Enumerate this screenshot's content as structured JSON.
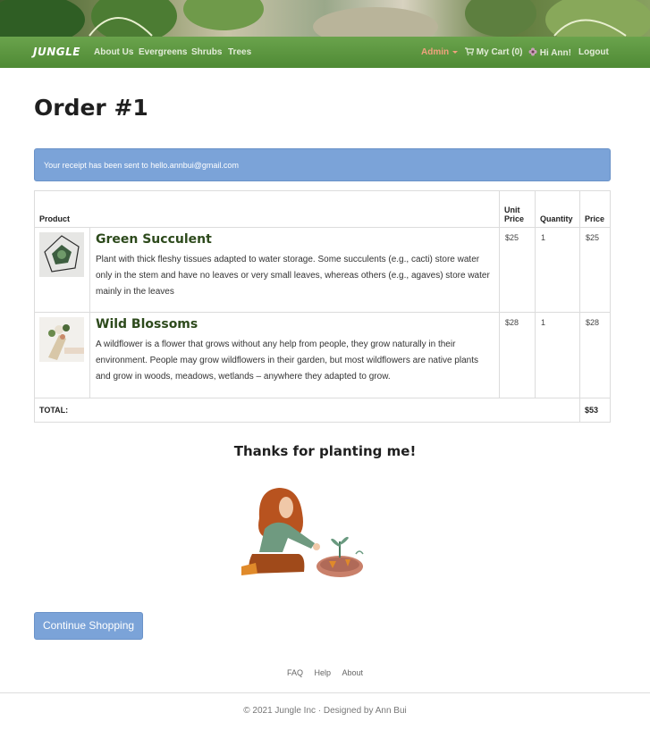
{
  "header": {
    "brand": "JUNGLE",
    "nav_links": [
      "About Us",
      "Evergreens",
      "Shrubs",
      "Trees"
    ],
    "admin_label": "Admin",
    "cart_label": "My Cart (0)",
    "greeting": "Hi Ann!",
    "logout_label": "Logout"
  },
  "order": {
    "title": "Order #1",
    "receipt_notice": "Your receipt has been sent to hello.annbui@gmail.com",
    "columns": {
      "product": "Product",
      "unit_price": "Unit Price",
      "quantity": "Quantity",
      "price": "Price"
    },
    "items": [
      {
        "name": "Green Succulent",
        "description": "Plant with thick fleshy tissues adapted to water storage. Some succulents (e.g., cacti) store water only in the stem and have no leaves or very small leaves, whereas others (e.g., agaves) store water mainly in the leaves",
        "unit_price": "$25",
        "quantity": "1",
        "price": "$25"
      },
      {
        "name": "Wild Blossoms",
        "description": "A wildflower is a flower that grows without any help from people, they grow naturally in their environment. People may grow wildflowers in their garden, but most wildflowers are native plants and grow in woods, meadows, wetlands – anywhere they adapted to grow.",
        "unit_price": "$28",
        "quantity": "1",
        "price": "$28"
      }
    ],
    "total_label": "TOTAL:",
    "total_value": "$53"
  },
  "thanks_message": "Thanks for planting me!",
  "continue_label": "Continue Shopping",
  "footer": {
    "links": [
      "FAQ",
      "Help",
      "About"
    ],
    "copyright": "© 2021 Jungle Inc · Designed by Ann Bui"
  },
  "colors": {
    "navbar": "#5a9a3e",
    "alert": "#7ba3d8",
    "button": "#7ba3d8",
    "admin": "#f1a27e",
    "product_name": "#2d4a1c"
  },
  "icons": [
    "cart-icon",
    "flower-icon",
    "caret-down-icon"
  ]
}
